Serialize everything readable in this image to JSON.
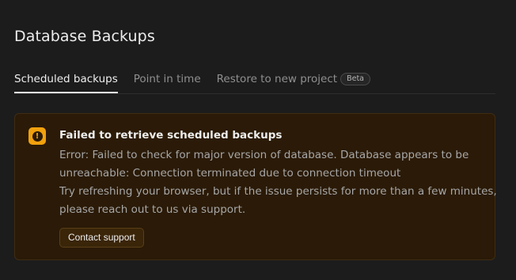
{
  "page": {
    "title": "Database Backups"
  },
  "tabs": [
    {
      "label": "Scheduled backups",
      "active": true
    },
    {
      "label": "Point in time",
      "active": false
    },
    {
      "label": "Restore to new project",
      "active": false,
      "badge": "Beta"
    }
  ],
  "alert": {
    "icon": "warning-icon",
    "icon_glyph": "!",
    "title": "Failed to retrieve scheduled backups",
    "lines": [
      "Error: Failed to check for major version of database. Database appears to be",
      "unreachable: Connection terminated due to connection timeout",
      "Try refreshing your browser, but if the issue persists for more than a few minutes,",
      "please reach out to us via support."
    ],
    "button_label": "Contact support"
  },
  "colors": {
    "background": "#1c1c1c",
    "alert_background": "#2a1a07",
    "warning_accent": "#f1a10d"
  }
}
